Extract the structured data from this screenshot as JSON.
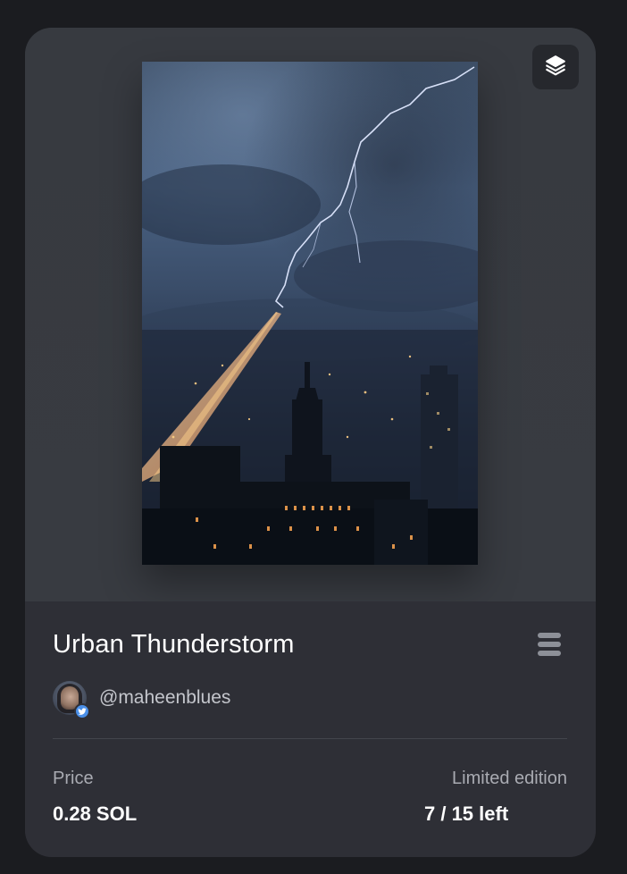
{
  "nft": {
    "title": "Urban Thunderstorm",
    "creator_handle": "@maheenblues",
    "price_label": "Price",
    "price_value": "0.28 SOL",
    "edition_label": "Limited edition",
    "edition_value": "7 / 15 left"
  },
  "icons": {
    "layers": "layers-icon",
    "chain": "solana-icon",
    "verified": "twitter-verified-icon"
  },
  "colors": {
    "page_background": "#1b1c20",
    "media_background": "#383b41",
    "info_background": "#2e2f36",
    "text_primary": "#ffffff",
    "text_secondary": "#a9abb2",
    "badge_blue": "#4a8fe8"
  }
}
